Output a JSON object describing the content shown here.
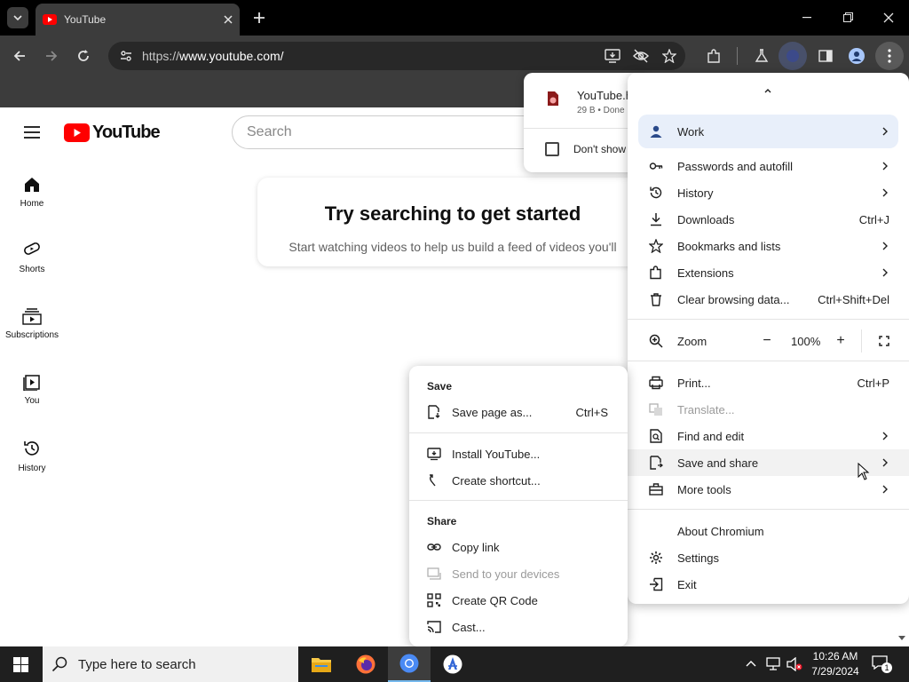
{
  "browser": {
    "tab_title": "YouTube",
    "url_prefix": "https://",
    "url_host": "www.youtube.com/",
    "url_full": "https://www.youtube.com/"
  },
  "youtube": {
    "logo_text": "YouTube",
    "search_placeholder": "Search",
    "nav": [
      {
        "label": "Home"
      },
      {
        "label": "Shorts"
      },
      {
        "label": "Subscriptions"
      },
      {
        "label": "You"
      },
      {
        "label": "History"
      }
    ],
    "empty_title": "Try searching to get started",
    "empty_text": "Start watching videos to help us build a feed of videos you'll"
  },
  "download_bubble": {
    "file_name": "YouTube.h",
    "file_status": "29 B • Done",
    "checkbox_label": "Don't show"
  },
  "menu": {
    "profile": "Work",
    "items": [
      {
        "label": "Passwords and autofill",
        "shortcut": "",
        "submenu": true
      },
      {
        "label": "History",
        "shortcut": "",
        "submenu": true
      },
      {
        "label": "Downloads",
        "shortcut": "Ctrl+J",
        "submenu": false
      },
      {
        "label": "Bookmarks and lists",
        "shortcut": "",
        "submenu": true
      },
      {
        "label": "Extensions",
        "shortcut": "",
        "submenu": true
      },
      {
        "label": "Clear browsing data...",
        "shortcut": "Ctrl+Shift+Del",
        "submenu": false
      }
    ],
    "zoom_label": "Zoom",
    "zoom_value": "100%",
    "zoom_minus": "−",
    "zoom_plus": "+",
    "items2": [
      {
        "label": "Print...",
        "shortcut": "Ctrl+P",
        "submenu": false,
        "disabled": false
      },
      {
        "label": "Translate...",
        "shortcut": "",
        "submenu": false,
        "disabled": true
      },
      {
        "label": "Find and edit",
        "shortcut": "",
        "submenu": true,
        "disabled": false
      },
      {
        "label": "Save and share",
        "shortcut": "",
        "submenu": true,
        "disabled": false
      },
      {
        "label": "More tools",
        "shortcut": "",
        "submenu": true,
        "disabled": false
      }
    ],
    "items3": [
      {
        "label": "About Chromium"
      },
      {
        "label": "Settings"
      },
      {
        "label": "Exit"
      }
    ]
  },
  "submenu": {
    "save_header": "Save",
    "save_page": "Save page as...",
    "save_page_shortcut": "Ctrl+S",
    "install": "Install YouTube...",
    "create_shortcut": "Create shortcut...",
    "share_header": "Share",
    "copy_link": "Copy link",
    "send_devices": "Send to your devices",
    "qr_code": "Create QR Code",
    "cast": "Cast..."
  },
  "taskbar": {
    "search_placeholder": "Type here to search",
    "time": "10:26 AM",
    "date": "7/29/2024",
    "notification_count": "1"
  },
  "colors": {
    "youtube_red": "#ff0000",
    "menu_highlight": "#e8effa",
    "chrome_toolbar": "#3c3c3c",
    "taskbar": "#1f1f1f"
  }
}
